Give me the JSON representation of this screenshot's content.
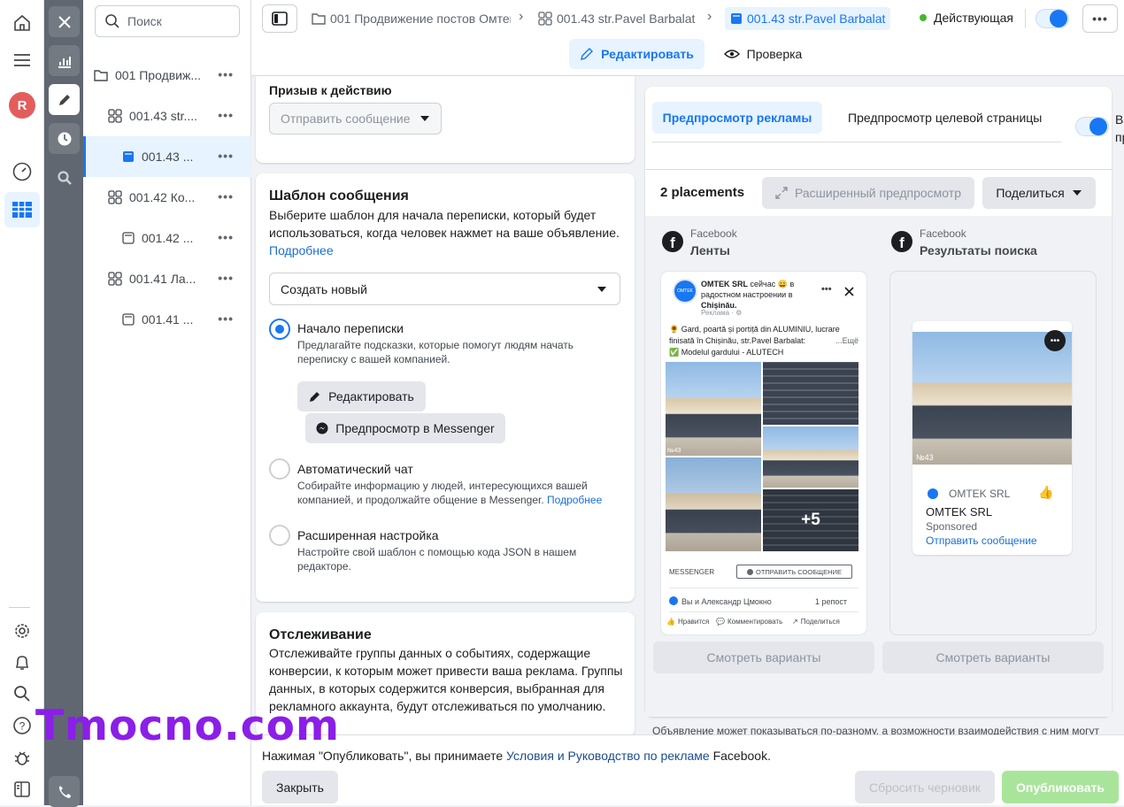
{
  "rail": {
    "avatar_letter": "R"
  },
  "search": {
    "placeholder": "Поиск"
  },
  "tree": [
    {
      "label": "001 Продвиж...",
      "icon": "folder-icon",
      "level": 0
    },
    {
      "label": "001.43 str....",
      "icon": "adset-grid-icon",
      "level": 1
    },
    {
      "label": "001.43 ...",
      "icon": "ad-icon",
      "level": 2,
      "selected": true
    },
    {
      "label": "001.42 Ко...",
      "icon": "adset-grid-icon",
      "level": 1
    },
    {
      "label": "001.42 ...",
      "icon": "ad-icon",
      "level": 2
    },
    {
      "label": "001.41 Ла...",
      "icon": "adset-grid-icon",
      "level": 1
    },
    {
      "label": "001.41 ...",
      "icon": "ad-icon",
      "level": 2
    }
  ],
  "breadcrumbs": [
    "001 Продвижение постов Омтек",
    "001.43 str.Pavel Barbalat",
    "001.43 str.Pavel Barbalat"
  ],
  "status": {
    "label": "Действующая",
    "color": "#42b72a"
  },
  "mode_tabs": {
    "edit": "Редактировать",
    "review": "Проверка"
  },
  "cta": {
    "title": "Призыв к действию",
    "value": "Отправить сообщение"
  },
  "template": {
    "title": "Шаблон сообщения",
    "desc": "Выберите шаблон для начала переписки, который будет использоваться, когда человек нажмет на ваше объявление.",
    "learn_more": "Подробнее",
    "select_value": "Создать новый",
    "options": [
      {
        "title": "Начало переписки",
        "desc": "Предлагайте подсказки, которые помогут людям начать переписку с вашей компанией.",
        "selected": true
      },
      {
        "title": "Автоматический чат",
        "desc": "Собирайте информацию у людей, интересующихся вашей компанией, и продолжайте общение в Messenger.",
        "link": "Подробнее"
      },
      {
        "title": "Расширенная настройка",
        "desc": "Настройте свой шаблон с помощью кода JSON в нашем редакторе."
      }
    ],
    "edit_btn": "Редактировать",
    "preview_messenger_btn": "Предпросмотр в Messenger"
  },
  "tracking": {
    "title": "Отслеживание",
    "desc": "Отслеживайте группы данных о событиях, содержащие конверсии, к которым может привести ваша реклама. Группы данных, в которых содержится конверсия, выбранная для рекламного аккаунта, будут отслеживаться по умолчанию."
  },
  "preview": {
    "tab_ad": "Предпросмотр рекламы",
    "tab_landing": "Предпросмотр целевой страницы",
    "toggle_label_cut": "В пр",
    "placements": "2 placements",
    "advanced_btn": "Расширенный предпросмотр",
    "share_btn": "Поделиться",
    "cols": [
      {
        "platform": "Facebook",
        "placement": "Ленты"
      },
      {
        "platform": "Facebook",
        "placement": "Результаты поиска"
      }
    ],
    "feed": {
      "page": "OMTEK SRL",
      "header_rest": "сейчас 😄 в радостном настроении в",
      "city": "Chișinău.",
      "sponsored": "Реклама · ⚙",
      "text_line1": "🌻 Gard, poartă și portiță din ALUMINIU, lucrare finisată în Chișinău, str.Pavel Barbalat:",
      "text_line2": "✅ Modelul gardului - ALUTECH",
      "more": "...Ещё",
      "plus": "+5",
      "tag": "№43",
      "messenger": "MESSENGER",
      "send_btn": "ОТПРАВИТЬ СООБЩЕНИЕ",
      "reactions": "Вы и Александр Цмокно",
      "reposts": "1 репост",
      "like": "Нравится",
      "comment": "Комментировать",
      "share": "Поделиться"
    },
    "search_card": {
      "page_small": "OMTEK SRL",
      "page": "OMTEK SRL",
      "sponsored": "Sponsored",
      "cta": "Отправить сообщение",
      "tag": "№43"
    },
    "variants_btn": "Смотреть варианты",
    "notice_cut": "Объявление может показываться по-разному, а возможности взаимодействия с ним могут"
  },
  "footer": {
    "text_before": "Нажимая \"Опубликовать\", вы принимаете ",
    "link": "Условия и Руководство по рекламе",
    "text_after": " Facebook.",
    "close": "Закрыть",
    "discard": "Сбросить черновик",
    "publish": "Опубликовать"
  },
  "watermark": "Tmocno.com",
  "colors": {
    "accent": "#1877f2",
    "publish_bg": "#a8e59b"
  }
}
